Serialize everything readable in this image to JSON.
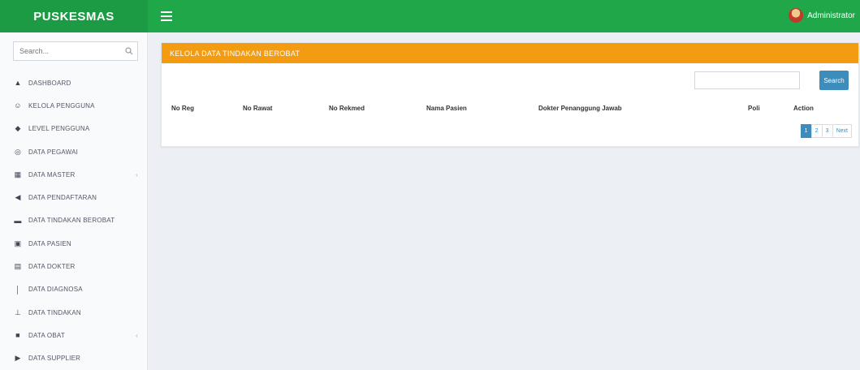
{
  "header": {
    "brand": "PUSKESMAS",
    "user_name": "Administrator"
  },
  "sidebar": {
    "search_placeholder": "Search...",
    "items": [
      {
        "label": "DASHBOARD",
        "icon": "dashboard-icon",
        "has_submenu": false
      },
      {
        "label": "KELOLA PENGGUNA",
        "icon": "user-icon",
        "has_submenu": false
      },
      {
        "label": "LEVEL PENGGUNA",
        "icon": "users-icon",
        "has_submenu": false
      },
      {
        "label": "DATA PEGAWAI",
        "icon": "employee-icon",
        "has_submenu": false
      },
      {
        "label": "DATA MASTER",
        "icon": "database-icon",
        "has_submenu": true
      },
      {
        "label": "DATA PENDAFTARAN",
        "icon": "registration-icon",
        "has_submenu": false
      },
      {
        "label": "DATA TINDAKAN BEROBAT",
        "icon": "treatment-icon",
        "has_submenu": false
      },
      {
        "label": "DATA PASIEN",
        "icon": "patient-icon",
        "has_submenu": false
      },
      {
        "label": "DATA DOKTER",
        "icon": "doctor-icon",
        "has_submenu": false
      },
      {
        "label": "DATA DIAGNOSA",
        "icon": "diagnosis-icon",
        "has_submenu": false
      },
      {
        "label": "DATA TINDAKAN",
        "icon": "action-icon",
        "has_submenu": false
      },
      {
        "label": "DATA OBAT",
        "icon": "medicine-icon",
        "has_submenu": true
      },
      {
        "label": "DATA SUPPLIER",
        "icon": "truck-icon",
        "has_submenu": false
      }
    ]
  },
  "main": {
    "box_title": "KELOLA DATA TINDAKAN BEROBAT",
    "search_button": "Search",
    "columns": [
      "No Reg",
      "No Rawat",
      "No Rekmed",
      "Nama Pasien",
      "Dokter Penanggung Jawab",
      "Poli",
      "Action"
    ],
    "pagination": [
      "1",
      "2",
      "3",
      "Next"
    ]
  },
  "colors": {
    "topbar": "#1fa74a",
    "box_header": "#f39c12",
    "primary": "#3c8dbc"
  }
}
